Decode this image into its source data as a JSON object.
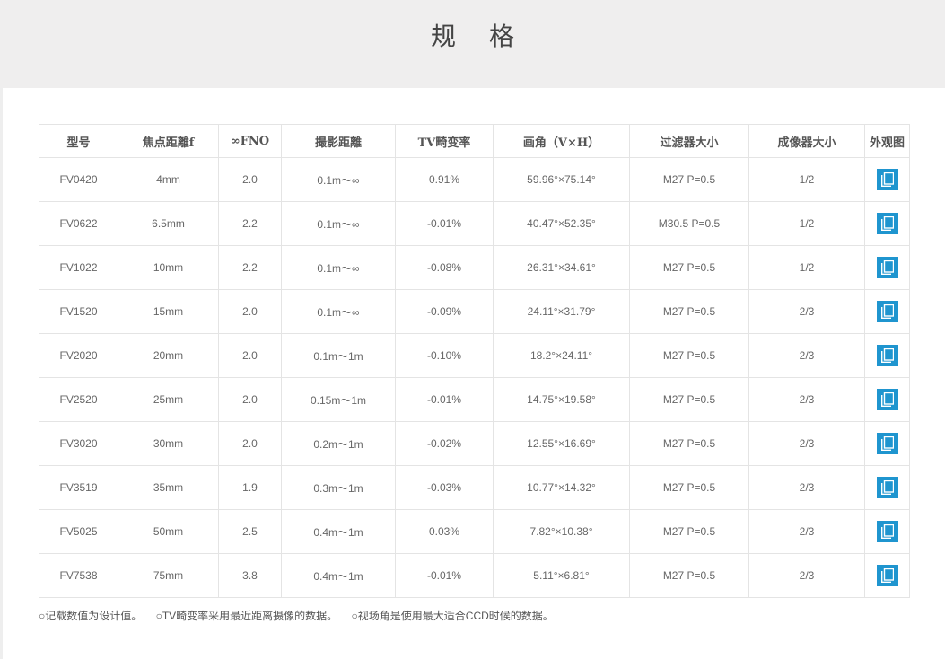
{
  "header": {
    "title": "规 格"
  },
  "table": {
    "columns": [
      "型号",
      "焦点距離f",
      "∞FNO",
      "撮影距離",
      "TV畸变率",
      "画角（V×H）",
      "过滤器大小",
      "成像器大小",
      "外观图"
    ],
    "rows": [
      [
        "FV0420",
        "4mm",
        "2.0",
        "0.1m〜∞",
        "0.91%",
        "59.96°×75.14°",
        "M27 P=0.5",
        "1/2"
      ],
      [
        "FV0622",
        "6.5mm",
        "2.2",
        "0.1m〜∞",
        "-0.01%",
        "40.47°×52.35°",
        "M30.5 P=0.5",
        "1/2"
      ],
      [
        "FV1022",
        "10mm",
        "2.2",
        "0.1m〜∞",
        "-0.08%",
        "26.31°×34.61°",
        "M27 P=0.5",
        "1/2"
      ],
      [
        "FV1520",
        "15mm",
        "2.0",
        "0.1m〜∞",
        "-0.09%",
        "24.11°×31.79°",
        "M27 P=0.5",
        "2/3"
      ],
      [
        "FV2020",
        "20mm",
        "2.0",
        "0.1m〜1m",
        "-0.10%",
        "18.2°×24.11°",
        "M27 P=0.5",
        "2/3"
      ],
      [
        "FV2520",
        "25mm",
        "2.0",
        "0.15m〜1m",
        "-0.01%",
        "14.75°×19.58°",
        "M27 P=0.5",
        "2/3"
      ],
      [
        "FV3020",
        "30mm",
        "2.0",
        "0.2m〜1m",
        "-0.02%",
        "12.55°×16.69°",
        "M27 P=0.5",
        "2/3"
      ],
      [
        "FV3519",
        "35mm",
        "1.9",
        "0.3m〜1m",
        "-0.03%",
        "10.77°×14.32°",
        "M27 P=0.5",
        "2/3"
      ],
      [
        "FV5025",
        "50mm",
        "2.5",
        "0.4m〜1m",
        "0.03%",
        "7.82°×10.38°",
        "M27 P=0.5",
        "2/3"
      ],
      [
        "FV7538",
        "75mm",
        "3.8",
        "0.4m〜1m",
        "-0.01%",
        "5.11°×6.81°",
        "M27 P=0.5",
        "2/3"
      ]
    ],
    "view_icon": "document-icon"
  },
  "notes": [
    "○记载数值为设计值。",
    "○TV畸变率采用最近距离摄像的数据。",
    "○视场角是使用最大适合CCD时候的数据。"
  ],
  "colors": {
    "accent": "#1f95cf",
    "link": "#3a6fa8"
  }
}
